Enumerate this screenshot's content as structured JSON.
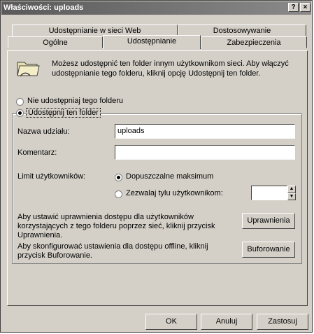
{
  "window": {
    "title": "Właściwości: uploads",
    "help_button": "?",
    "close_button": "×"
  },
  "tabs": {
    "row1": [
      {
        "label": "Udostępnianie w sieci Web"
      },
      {
        "label": "Dostosowywanie"
      }
    ],
    "row2": [
      {
        "label": "Ogólne"
      },
      {
        "label": "Udostępnianie"
      },
      {
        "label": "Zabezpieczenia"
      }
    ],
    "active": "Udostępnianie"
  },
  "panel": {
    "info_line1": "Możesz udostępnić ten folder innym użytkownikom sieci. Aby włączyć",
    "info_line2": "udostępnianie tego folderu, kliknij opcję Udostępnij ten folder.",
    "radio_no_share": "Nie udostępniaj tego folderu",
    "radio_share": "Udostępnij ten folder",
    "share_name_label": "Nazwa udziału:",
    "share_name_value": "uploads",
    "comment_label": "Komentarz:",
    "comment_value": "",
    "user_limit_label": "Limit użytkowników:",
    "limit_max_label": "Dopuszczalne maksimum",
    "limit_allow_label": "Zezwalaj tylu użytkownikom:",
    "limit_allow_value": "",
    "perm_text_line1": "Aby ustawić uprawnienia dostępu dla użytkowników",
    "perm_text_line2": "korzystających z tego folderu poprzez sieć, kliknij przycisk",
    "perm_text_line3": "Uprawnienia.",
    "perm_button": "Uprawnienia",
    "cache_text_line1": "Aby skonfigurować ustawienia dla dostępu offline, kliknij",
    "cache_text_line2": "przycisk Buforowanie.",
    "cache_button": "Buforowanie"
  },
  "footer": {
    "ok": "OK",
    "cancel": "Anuluj",
    "apply": "Zastosuj"
  },
  "radio_state": {
    "share_selected": "share",
    "limit_selected": "max"
  }
}
